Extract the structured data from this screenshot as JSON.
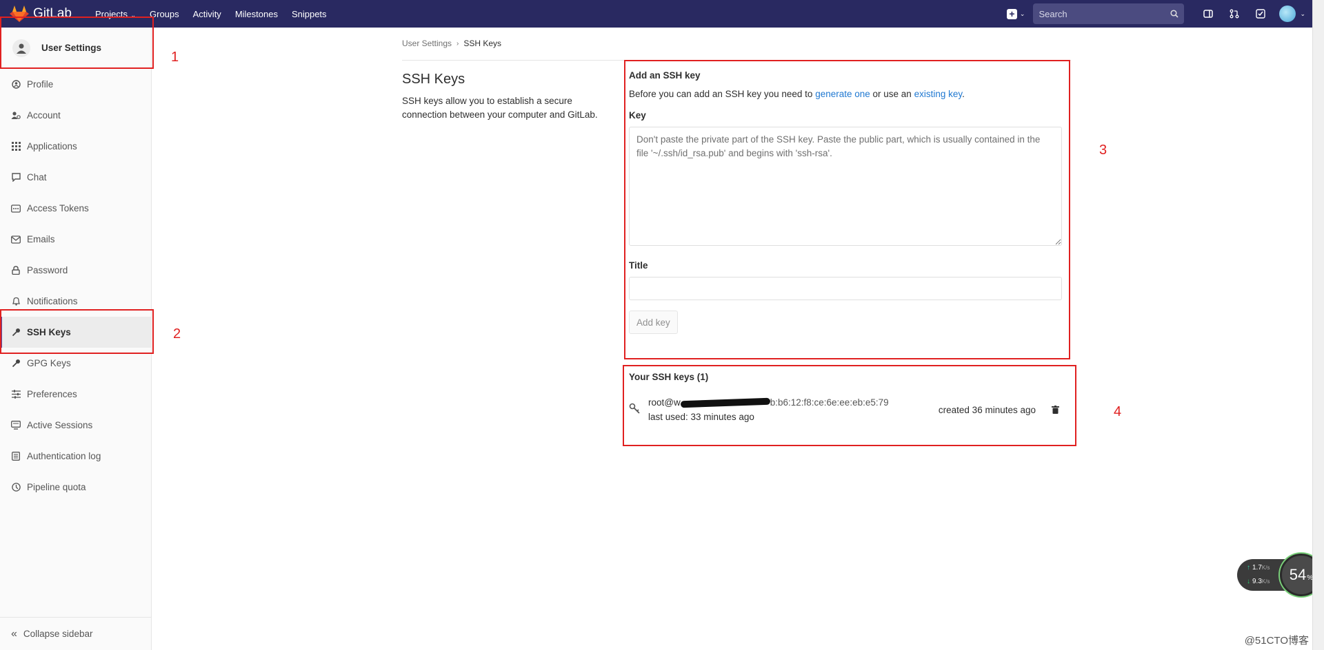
{
  "navbar": {
    "brand": "GitLab",
    "links": [
      {
        "label": "Projects",
        "has_dropdown": true
      },
      {
        "label": "Groups"
      },
      {
        "label": "Activity"
      },
      {
        "label": "Milestones"
      },
      {
        "label": "Snippets"
      }
    ],
    "search_placeholder": "Search",
    "icons": [
      "plus-icon",
      "search-icon",
      "sidebar-toggle-icon",
      "merge-request-icon",
      "todo-icon",
      "avatar"
    ]
  },
  "sidebar": {
    "title": "User Settings",
    "items": [
      {
        "label": "Profile",
        "icon": "profile-icon"
      },
      {
        "label": "Account",
        "icon": "account-icon"
      },
      {
        "label": "Applications",
        "icon": "applications-icon"
      },
      {
        "label": "Chat",
        "icon": "chat-icon"
      },
      {
        "label": "Access Tokens",
        "icon": "token-icon"
      },
      {
        "label": "Emails",
        "icon": "email-icon"
      },
      {
        "label": "Password",
        "icon": "lock-icon"
      },
      {
        "label": "Notifications",
        "icon": "bell-icon"
      },
      {
        "label": "SSH Keys",
        "icon": "key-icon",
        "active": true
      },
      {
        "label": "GPG Keys",
        "icon": "key-icon"
      },
      {
        "label": "Preferences",
        "icon": "preferences-icon"
      },
      {
        "label": "Active Sessions",
        "icon": "monitor-icon"
      },
      {
        "label": "Authentication log",
        "icon": "log-icon"
      },
      {
        "label": "Pipeline quota",
        "icon": "quota-icon"
      }
    ],
    "collapse_label": "Collapse sidebar"
  },
  "breadcrumb": {
    "parent": "User Settings",
    "current": "SSH Keys"
  },
  "intro": {
    "heading": "SSH Keys",
    "description": "SSH keys allow you to establish a secure connection between your computer and GitLab."
  },
  "add_key": {
    "heading": "Add an SSH key",
    "text_before": "Before you can add an SSH key you need to ",
    "link1": "generate one",
    "text_mid": " or use an ",
    "link2": "existing key",
    "text_after": ".",
    "key_label": "Key",
    "key_placeholder": "Don't paste the private part of the SSH key. Paste the public part, which is usually contained in the file '~/.ssh/id_rsa.pub' and begins with 'ssh-rsa'.",
    "title_label": "Title",
    "title_value": "",
    "button": "Add key"
  },
  "your_keys": {
    "heading": "Your SSH keys (1)",
    "items": [
      {
        "fingerprint_start": "root@w",
        "fingerprint_end": "b:b6:12:f8:ce:6e:ee:eb:e5:79",
        "last_used": "last used: 33 minutes ago",
        "created": "created 36 minutes ago"
      }
    ]
  },
  "annotations": {
    "colour": "#e02020",
    "labels": [
      "1",
      "2",
      "3",
      "4"
    ]
  },
  "speed_widget": {
    "up": "1.7",
    "up_unit": "K/s",
    "down": "9.3",
    "down_unit": "K/s",
    "percent": "54",
    "percent_unit": "%"
  },
  "watermark": "@51CTO博客"
}
